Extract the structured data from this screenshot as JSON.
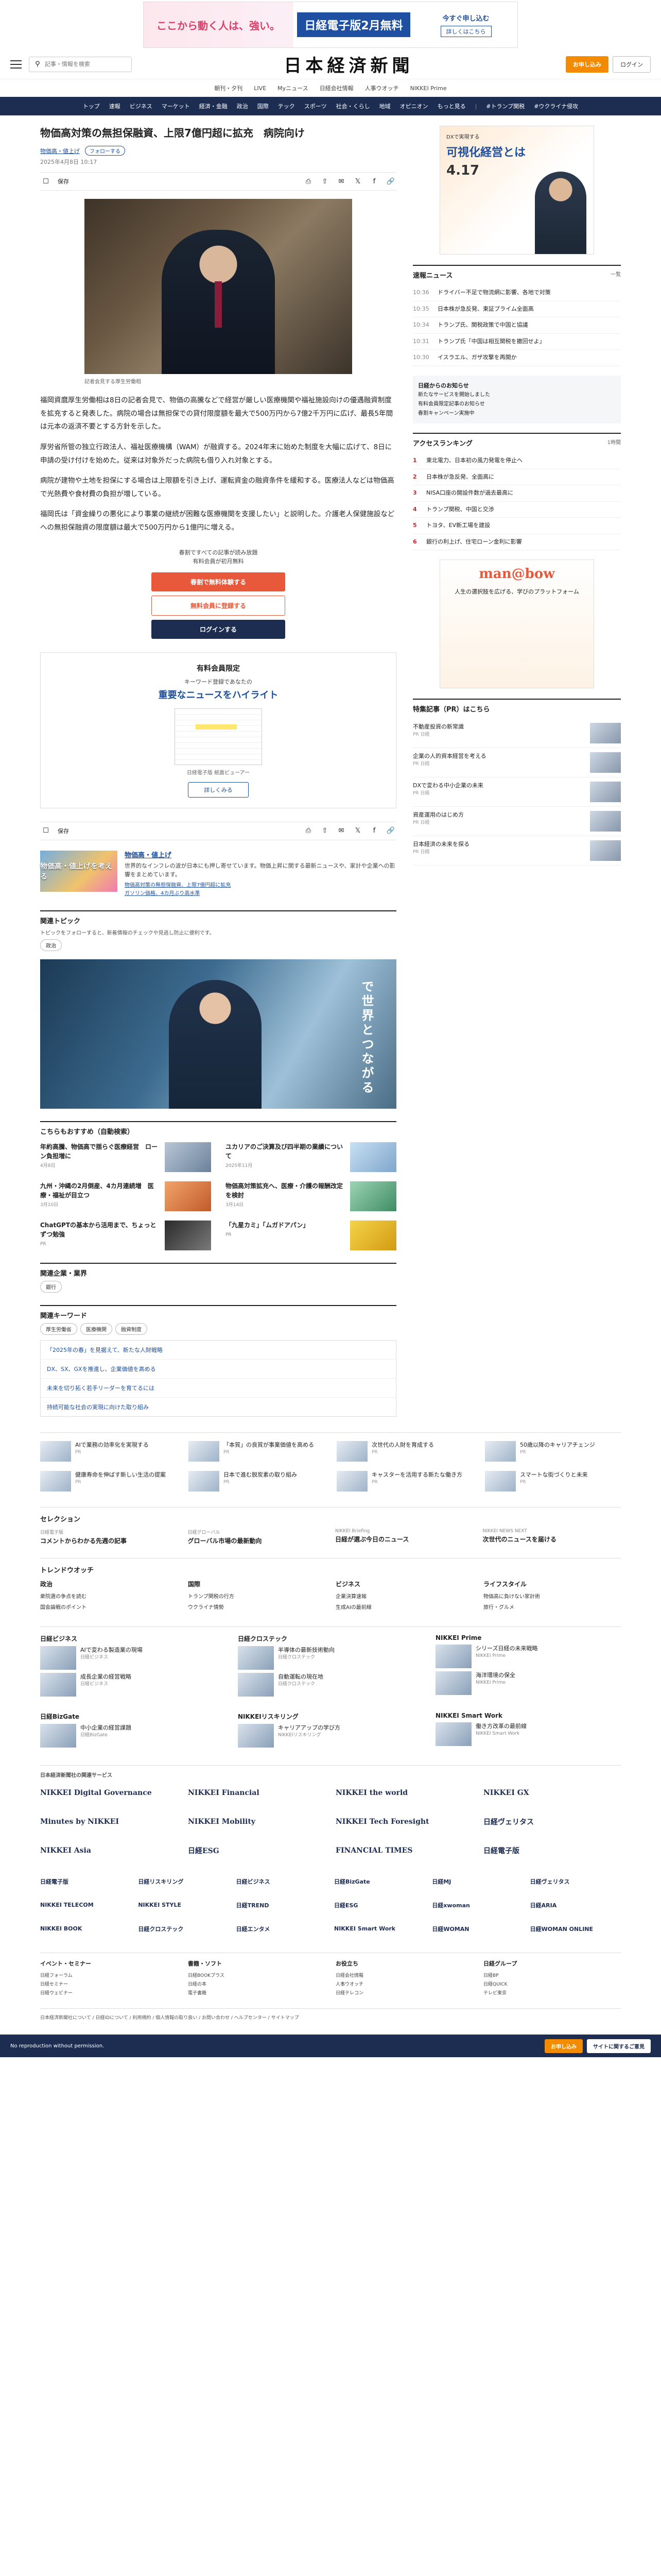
{
  "ad_top": {
    "left": "ここから動く人は、強い。",
    "mid": "日経電子版2月無料",
    "right_line1": "今すぐ申し込む",
    "right_line2": "詳しくはこちら"
  },
  "header": {
    "search_placeholder": "記事・情報を検索",
    "logo": "日本経済新聞",
    "subscribe": "お申し込み",
    "login": "ログイン"
  },
  "subnav": [
    "朝刊・夕刊",
    "LIVE",
    "Myニュース",
    "日経会社情報",
    "人事ウオッチ",
    "NIKKEI Prime"
  ],
  "mainnav": [
    "トップ",
    "速報",
    "ビジネス",
    "マーケット",
    "経済・金融",
    "政治",
    "国際",
    "テック",
    "スポーツ",
    "社会・くらし",
    "地域",
    "オピニオン",
    "もっと見る",
    "#トランプ関税",
    "#ウクライナ侵攻"
  ],
  "article": {
    "title": "物価高対策の無担保融資、上限7億円超に拡充　病院向け",
    "tag": "物価高・値上げ",
    "follow": "フォローする",
    "date": "2025年4月8日 10:17",
    "save": "保存",
    "caption": "記者会見する厚生労働相",
    "paragraphs": [
      "福岡資麿厚生労働相は8日の記者会見で、物価の高騰などで経営が厳しい医療機関や福祉施設向けの優遇融資制度を拡充すると発表した。病院の場合は無担保での貸付限度額を最大で500万円から7億2千万円に広げ、最長5年間は元本の返済不要とする方針を示した。",
      "厚労省所管の独立行政法人、福祉医療機構（WAM）が融資する。2024年末に始めた制度を大幅に広げて、8日に申請の受け付けを始めた。従来は対象外だった病院も借り入れ対象とする。",
      "病院が建物や土地を担保にする場合は上限額を引き上げ、運転資金の融資条件を緩和する。医療法人などは物価高で光熱費や食材費の負担が増している。",
      "福岡氏は「資金繰りの悪化により事業の継続が困難な医療機関を支援したい」と説明した。介護老人保健施設などへの無担保融資の限度額は最大で500万円から1億円に増える。"
    ]
  },
  "paywall": {
    "note1": "春割ですべての記事が読み放題",
    "note2": "有料会員が初月無料",
    "btn1": "春割で無料体験する",
    "btn2": "無料会員に登録する",
    "btn3": "ログインする"
  },
  "member_box": {
    "title": "有料会員限定",
    "sub": "キーワード登録であなたの",
    "hl": "重要なニュースをハイライト",
    "mock_cap": "日経電子版 紙面ビューアー",
    "detail": "詳しくみる"
  },
  "related": {
    "thumb": "物価高・値上げを考える",
    "name": "物価高・値上げ",
    "desc": "世界的なインフレの波が日本にも押し寄せています。物価上昇に関する最新ニュースや、家計や企業への影響をまとめています。",
    "links": [
      "物価高対策の無担保融資、上限7億円超に拡充",
      "ガソリン価格、4カ月ぶり高水準"
    ]
  },
  "topics": {
    "title": "関連トピック",
    "desc": "トピックをフォローすると、新着情報のチェックや見逃し防止に便利です。",
    "chip": "政治"
  },
  "video": {
    "text": "で世界とつながる"
  },
  "recommend": {
    "title": "こちらもおすすめ（自動検索）",
    "items": [
      {
        "t": "年約高騰、物価高で揺らぐ医療経営　ローン負担増に",
        "d": "4月8日"
      },
      {
        "t": "ユカリアのご決算及び四半期の業績について",
        "d": "2025年11月"
      },
      {
        "t": "九州・沖縄の2月倒産、4カ月連続増　医療・福祉が目立つ",
        "d": "3月10日"
      },
      {
        "t": "物価高対策拡充へ、医療・介護の報酬改定を検討",
        "d": "3月14日"
      },
      {
        "t": "ChatGPTの基本から活用まで、ちょっとずつ勉強",
        "d": "PR"
      },
      {
        "t": "「九星カミ」「ムガドアパン」",
        "d": "PR"
      }
    ]
  },
  "keywords": {
    "title": "関連企業・業界",
    "chip": "銀行",
    "title2": "関連キーワード",
    "chips2": [
      "厚生労働省",
      "医療機関",
      "融資制度"
    ]
  },
  "kw_list": [
    "「2025年の春」を見据えて、新たな人財戦略",
    "DX、SX、GXを推進し、企業価値を高める",
    "未来を切り拓く若手リーダーを育てるには",
    "持続可能な社会の実現に向けた取り組み"
  ],
  "side": {
    "ad": {
      "a1": "DXで実現する",
      "a2": "可視化経営とは",
      "a3": "4.17"
    },
    "news_title": "速報ニュース",
    "news_more": "一覧",
    "news": [
      {
        "tm": "10:36",
        "t": "ドライバー不足で物流網に影響、各地で対策"
      },
      {
        "tm": "10:35",
        "t": "日本株が急反発、東証プライム全面高"
      },
      {
        "tm": "10:34",
        "t": "トランプ氏、関税政策で中国と協議"
      },
      {
        "tm": "10:31",
        "t": "トランプ氏「中国は相互関税を撤回せよ」"
      },
      {
        "tm": "10:30",
        "t": "イスラエル、ガザ攻撃を再開か"
      }
    ],
    "notice_title": "日経からのお知らせ",
    "notice_items": [
      "新たなサービスを開始しました",
      "有料会員限定記事のお知らせ",
      "春割キャンペーン実施中"
    ],
    "ranking_title": "アクセスランキング",
    "ranking_more": "1時間",
    "ranking": [
      "東北電力、日本初の風力発電を停止へ",
      "日本株が急反発、全面高に",
      "NISA口座の開設件数が過去最高に",
      "トランプ関税、中国と交渉",
      "トヨタ、EV新工場を建設",
      "銀行の利上げ、住宅ローン金利に影響"
    ],
    "ad2_m": "man@bow",
    "ad2_q": "人生の選択肢を広げる、学びのプラットフォーム",
    "pr_title": "特集記事（PR）はこちら",
    "pr": [
      {
        "t": "不動産投資の新常識",
        "s": "PR 日経"
      },
      {
        "t": "企業の人的資本経営を考える",
        "s": "PR 日経"
      },
      {
        "t": "DXで変わる中小企業の未来",
        "s": "PR 日経"
      },
      {
        "t": "資産運用のはじめ方",
        "s": "PR 日経"
      },
      {
        "t": "日本経済の未来を探る",
        "s": "PR 日経"
      }
    ]
  },
  "pr_strip": [
    {
      "t": "AIで業務の効率化を実現する",
      "s": "PR"
    },
    {
      "t": "「本質」の良質が事業価値を高める",
      "s": "PR"
    },
    {
      "t": "次世代の人財を育成する",
      "s": "PR"
    },
    {
      "t": "50歳以降のキャリアチェンジ",
      "s": "PR"
    },
    {
      "t": "健康寿命を伸ばす新しい生活の提案",
      "s": "PR"
    },
    {
      "t": "日本で進む脱炭素の取り組み",
      "s": "PR"
    },
    {
      "t": "キャスターを活用する新たな働き方",
      "s": "PR"
    },
    {
      "t": "スマートな街づくりと未来",
      "s": "PR"
    }
  ],
  "selection": {
    "title": "セレクション",
    "items": [
      {
        "s": "日経電子版",
        "t": "コメントからわかる先週の記事"
      },
      {
        "s": "日経グローバル",
        "t": "グローバル市場の最新動向"
      },
      {
        "s": "NIKKEI Briefing",
        "t": "日経が選ぶ今日のニュース"
      },
      {
        "s": "NIKKEI NEWS NEXT",
        "t": "次世代のニュースを届ける"
      }
    ]
  },
  "trend": {
    "title": "トレンドウオッチ",
    "cols": [
      {
        "h": "政治",
        "items": [
          "衆院選の争点を読む",
          "国会論戦のポイント"
        ]
      },
      {
        "h": "国際",
        "items": [
          "トランプ関税の行方",
          "ウクライナ情勢"
        ]
      },
      {
        "h": "ビジネス",
        "items": [
          "企業決算速報",
          "生成AIの最前線"
        ]
      },
      {
        "h": "ライフスタイル",
        "items": [
          "物価高に負けない家計術",
          "旅行・グルメ"
        ]
      }
    ]
  },
  "brands": [
    {
      "h": "日経ビジネス",
      "rows": [
        {
          "t": "AIで変わる製造業の現場",
          "s": "日経ビジネス"
        },
        {
          "t": "成長企業の経営戦略",
          "s": "日経ビジネス"
        }
      ]
    },
    {
      "h": "日経クロステック",
      "rows": [
        {
          "t": "半導体の最新技術動向",
          "s": "日経クロステック"
        },
        {
          "t": "自動運転の現在地",
          "s": "日経クロステック"
        }
      ]
    },
    {
      "h": "NIKKEI Prime",
      "rows": [
        {
          "t": "シリーズ日経の未来戦略",
          "s": "NIKKEI Prime"
        },
        {
          "t": "海洋環境の保全",
          "s": "NIKKEI Prime"
        }
      ]
    },
    {
      "h": "日経BizGate",
      "rows": [
        {
          "t": "中小企業の経営課題",
          "s": "日経BizGate"
        }
      ]
    },
    {
      "h": "NIKKEIリスキリング",
      "rows": [
        {
          "t": "キャリアアップの学び方",
          "s": "NIKKEIリスキリング"
        }
      ]
    },
    {
      "h": "NIKKEI Smart Work",
      "rows": [
        {
          "t": "働き方改革の最前線",
          "s": "NIKKEI Smart Work"
        }
      ]
    }
  ],
  "logos_title": "日本経済新聞社の関連サービス",
  "logos": [
    "NIKKEI Digital Governance",
    "NIKKEI Financial",
    "NIKKEI the world",
    "NIKKEI GX",
    "Minutes by NIKKEI",
    "NIKKEI Mobility",
    "NIKKEI Tech Foresight",
    "日経ヴェリタス",
    "NIKKEI Asia",
    "日経ESG",
    "FINANCIAL TIMES",
    "日経電子版"
  ],
  "logos_small": [
    "日経電子版",
    "日経リスキリング",
    "日経ビジネス",
    "日経BizGate",
    "日経MJ",
    "日経ヴェリタス",
    "NIKKEI TELECOM",
    "NIKKEI STYLE",
    "日経TREND",
    "日経ESG",
    "日経xwoman",
    "日経ARIA",
    "NIKKEI BOOK",
    "日経クロステック",
    "日経エンタメ",
    "NIKKEI Smart Work",
    "日経WOMAN",
    "日経WOMAN ONLINE"
  ],
  "foot_links": [
    {
      "h": "イベント・セミナー",
      "items": [
        "日経フォーラム",
        "日経セミナー",
        "日経ウェビナー"
      ]
    },
    {
      "h": "書籍・ソフト",
      "items": [
        "日経BOOKプラス",
        "日経の本",
        "電子書籍"
      ]
    },
    {
      "h": "お役立ち",
      "items": [
        "日経会社情報",
        "人事ウオッチ",
        "日経テレコン"
      ]
    },
    {
      "h": "日経グループ",
      "items": [
        "日経BP",
        "日経QUICK",
        "テレビ東京"
      ]
    }
  ],
  "groups_text": "日本経済新聞社について / 日経IDについて / 利用規約 / 個人情報の取り扱い / お問い合わせ / ヘルプセンター / サイトマップ",
  "footer": {
    "copy": "No reproduction without permission.",
    "btn1": "お申し込み",
    "btn2": "サイトに関するご意見"
  }
}
